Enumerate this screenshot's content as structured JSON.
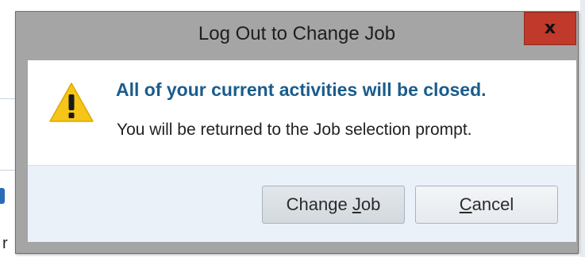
{
  "dialog": {
    "title": "Log Out to Change Job",
    "close_label": "x",
    "heading": "All of your current activities will be closed.",
    "message": "You will be returned to the Job selection prompt.",
    "buttons": {
      "change_job": {
        "before": "Change ",
        "mnemonic": "J",
        "after": "ob"
      },
      "cancel": {
        "before": "",
        "mnemonic": "C",
        "after": "ancel"
      }
    }
  },
  "background": {
    "visible_char": "r"
  },
  "icons": {
    "warning": "warning-triangle-icon",
    "close": "close-icon"
  },
  "colors": {
    "heading": "#1a5c8c",
    "close_button": "#c0392b",
    "warning_fill": "#f5c518",
    "footer_bg": "#eaf1f8",
    "frame": "#a5a5a5"
  }
}
